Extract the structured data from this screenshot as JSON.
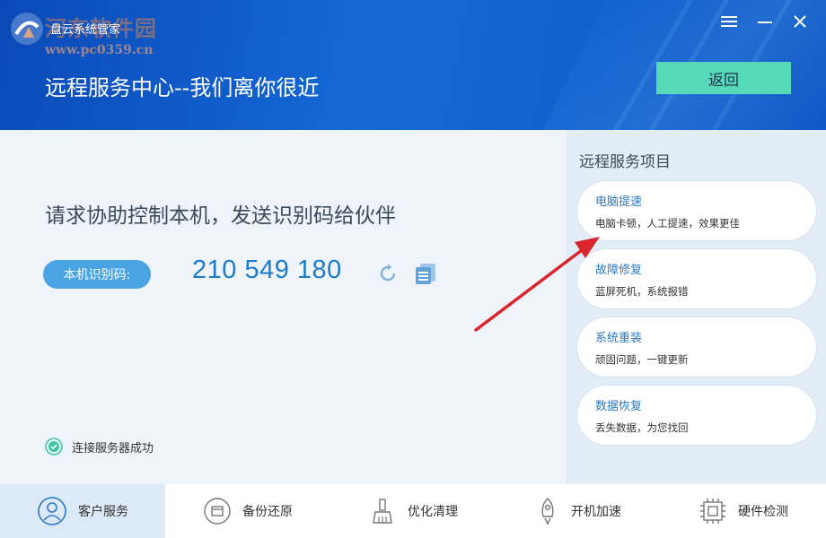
{
  "app": {
    "title": "盘云系统管家",
    "watermark": "河东软件园",
    "watermark_url": "www.pc0359.cn"
  },
  "header": {
    "title": "远程服务中心--我们离你很近",
    "back_label": "返回"
  },
  "main": {
    "prompt": "请求协助控制本机，发送识别码给伙伴",
    "id_label": "本机识别码:",
    "id_code": "210 549 180",
    "status": "连接服务器成功"
  },
  "services": {
    "title": "远程服务项目",
    "items": [
      {
        "title": "电脑提速",
        "desc": "电脑卡顿，人工提速，效果更佳"
      },
      {
        "title": "故障修复",
        "desc": "蓝屏死机，系统报错"
      },
      {
        "title": "系统重装",
        "desc": "顽固问题，一键更新"
      },
      {
        "title": "数据恢复",
        "desc": "丢失数据，为您找回"
      }
    ]
  },
  "tabs": [
    {
      "label": "客户服务",
      "icon": "user-icon"
    },
    {
      "label": "备份还原",
      "icon": "backup-icon"
    },
    {
      "label": "优化清理",
      "icon": "broom-icon"
    },
    {
      "label": "开机加速",
      "icon": "rocket-icon"
    },
    {
      "label": "硬件检测",
      "icon": "chip-icon"
    }
  ],
  "colors": {
    "accent": "#55d9b7",
    "header": "#1469d6",
    "code": "#1c7ccc",
    "arrow": "#d9262c"
  }
}
